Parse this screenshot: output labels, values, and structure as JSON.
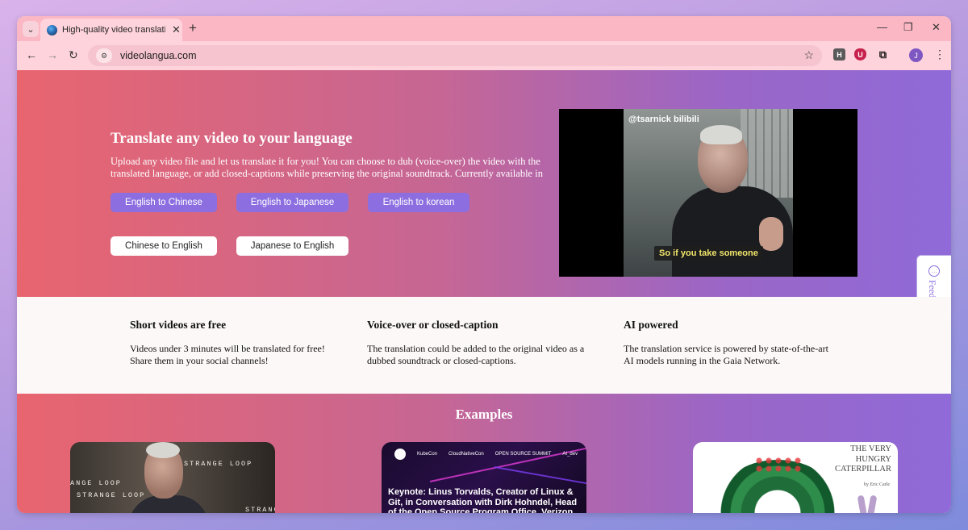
{
  "browser": {
    "tab_title": "High-quality video translation",
    "tab_close": "✕",
    "new_tab": "+",
    "menu_icon": "⌄",
    "url": "videolangua.com",
    "window_controls": [
      "—",
      "❐",
      "✕"
    ],
    "avatar_letter": "J",
    "extension_h": "H",
    "extension_u": "U"
  },
  "hero": {
    "title": "Translate any video to your language",
    "description": "Upload any video file and let us translate it for you! You can choose to dub (voice-over) the video with the translated language, or add closed-captions while preserving the original soundtrack. Currently available in",
    "buttons_row1": [
      "English to Chinese",
      "English to Japanese",
      "English to korean"
    ],
    "buttons_row2": [
      "Chinese to English",
      "Japanese to English"
    ]
  },
  "video": {
    "watermark": "@tsarnick bilibili",
    "subtitle": "So if you take someone"
  },
  "feedback": {
    "label": "Feedback"
  },
  "features": [
    {
      "title": "Short videos are free",
      "desc": "Videos under 3 minutes will be translated for free! Share them in your social channels!"
    },
    {
      "title": "Voice-over or closed-caption",
      "desc": "The translation could be added to the original video as a dubbed soundtrack or closed-captions."
    },
    {
      "title": "AI powered",
      "desc": "The translation service is powered by state-of-the-art AI models running in the Gaia Network."
    }
  ],
  "examples": {
    "title": "Examples",
    "card1": {
      "texts": [
        "STRANGE LOOP",
        "ANGE LOOP",
        "STRANGE LOOP",
        "STRANG"
      ]
    },
    "card2": {
      "logos": [
        "KubeCon",
        "CloudNativeCon",
        "OPEN SOURCE SUMMIT",
        "AI_dev"
      ],
      "caption": "Keynote: Linus Torvalds, Creator of Linux & Git, in Conversation with Dirk Hohndel, Head of the Open Source Program Office, Verizon"
    },
    "card3": {
      "book_title": "THE VERY HUNGRY CATERPILLAR",
      "author": "by Eric Carle"
    }
  }
}
